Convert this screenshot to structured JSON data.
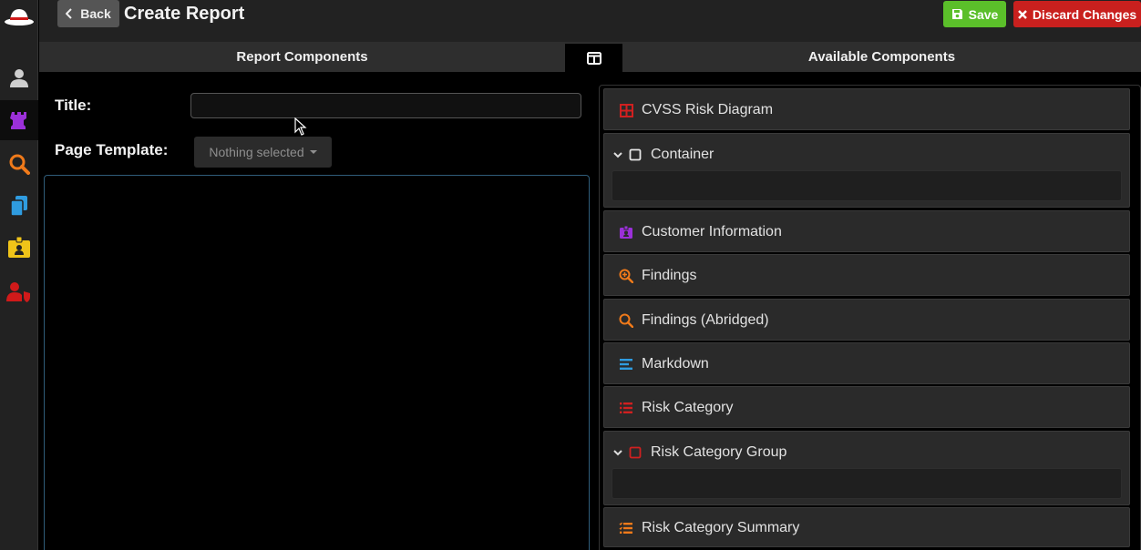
{
  "header": {
    "back_label": "Back",
    "title": "Create Report",
    "save_label": "Save",
    "discard_label": "Discard Changes"
  },
  "columns": {
    "left_title": "Report Components",
    "right_title": "Available Components",
    "toggle_icon": "columns-icon"
  },
  "form": {
    "title_label": "Title:",
    "title_value": "",
    "template_label": "Page Template:",
    "template_value": "Nothing selected"
  },
  "sidebar": {
    "items": [
      {
        "icon": "user-icon",
        "color": "#cfcfcf"
      },
      {
        "icon": "rook-icon",
        "color": "#9b30d9",
        "active": true
      },
      {
        "icon": "search-icon",
        "color": "#f07a1a"
      },
      {
        "icon": "copy-icon",
        "color": "#2f9ce0"
      },
      {
        "icon": "id-badge-icon",
        "color": "#f0c419"
      },
      {
        "icon": "user-shield-icon",
        "color": "#d01a1a"
      }
    ]
  },
  "components": [
    {
      "label": "CVSS Risk Diagram",
      "icon": "table-icon",
      "color": "#d02020",
      "expandable": false
    },
    {
      "label": "Container",
      "icon": "square-icon",
      "color": "#e6e6e6",
      "expandable": true
    },
    {
      "label": "Customer Information",
      "icon": "id-card-icon",
      "color": "#9b30d9",
      "expandable": false
    },
    {
      "label": "Findings",
      "icon": "search-plus-icon",
      "color": "#f07a1a",
      "expandable": false
    },
    {
      "label": "Findings (Abridged)",
      "icon": "search-icon",
      "color": "#f07a1a",
      "expandable": false
    },
    {
      "label": "Markdown",
      "icon": "align-icon",
      "color": "#2f9ce0",
      "expandable": false
    },
    {
      "label": "Risk Category",
      "icon": "list-icon",
      "color": "#d02020",
      "expandable": false
    },
    {
      "label": "Risk Category Group",
      "icon": "square-icon",
      "color": "#d02020",
      "expandable": true
    },
    {
      "label": "Risk Category Summary",
      "icon": "list-icon",
      "color": "#f07a1a",
      "expandable": false
    }
  ],
  "colors": {
    "save": "#5bbf2a",
    "discard": "#c9201e",
    "dropzone_border": "#2f5d7a"
  }
}
